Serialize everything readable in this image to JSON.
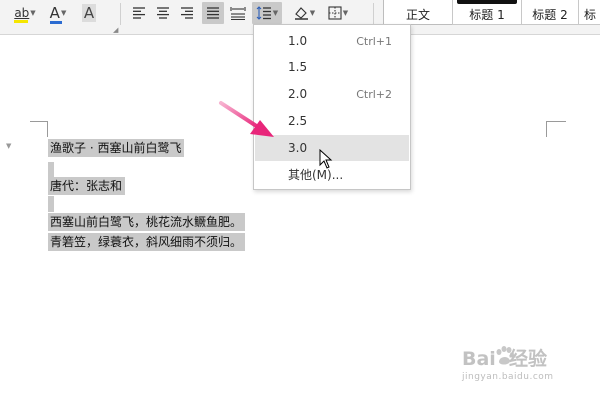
{
  "toolbar": {
    "highlight_glyph": "ab",
    "font_color_glyph": "A",
    "char_shading_glyph": "A",
    "icons": [
      "highlight-icon",
      "font-color-icon",
      "character-shading-icon",
      "align-left-icon",
      "align-center-icon",
      "align-right-icon",
      "justify-icon",
      "distributed-icon",
      "line-spacing-icon",
      "shading-icon",
      "border-icon"
    ]
  },
  "styles": {
    "items": [
      "正文",
      "标题 1",
      "标题 2",
      "标"
    ]
  },
  "line_spacing_menu": {
    "options": [
      {
        "value": "1.0",
        "shortcut": "Ctrl+1"
      },
      {
        "value": "1.5",
        "shortcut": ""
      },
      {
        "value": "2.0",
        "shortcut": "Ctrl+2"
      },
      {
        "value": "2.5",
        "shortcut": ""
      },
      {
        "value": "3.0",
        "shortcut": ""
      },
      {
        "value": "其他(M)...",
        "shortcut": ""
      }
    ],
    "hovered": "3.0"
  },
  "document": {
    "lines": [
      "渔歌子 · 西塞山前白鹭飞",
      "唐代：张志和",
      "西塞山前白鹭飞，桃花流水鳜鱼肥。",
      "青箬笠，绿蓑衣，斜风细雨不须归。"
    ]
  },
  "watermark": {
    "brand": "Bai  经验",
    "url": "jingyan.baidu.com"
  },
  "colors": {
    "selection": "#c9c9c9",
    "annotation_arrow": "#e8267a",
    "font_color_bar": "#2b6bd1",
    "highlight_bar": "#f5e600"
  }
}
